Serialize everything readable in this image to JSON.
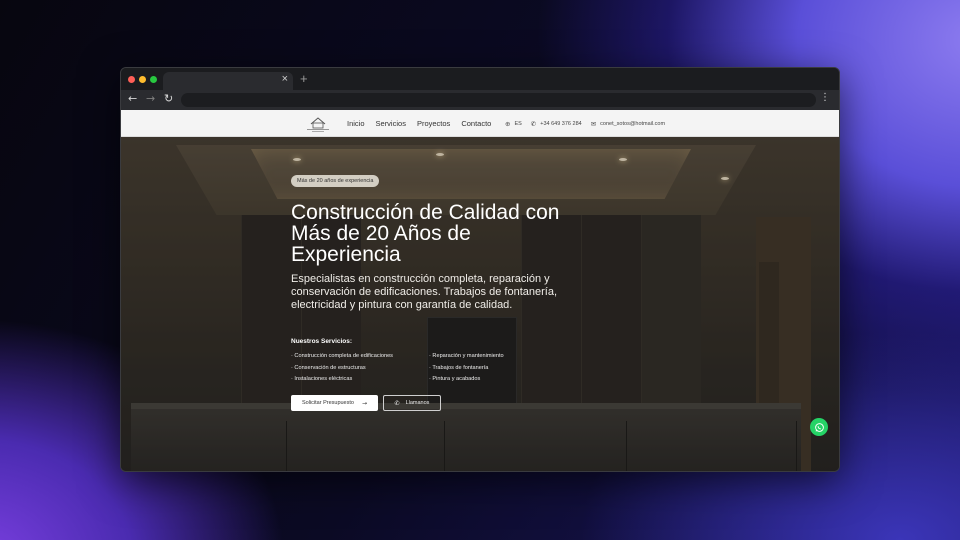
{
  "browser": {
    "tab_close": "×",
    "new_tab": "+",
    "back": "←",
    "forward": "→",
    "reload": "↻",
    "menu": "⋮"
  },
  "header": {
    "nav": [
      "Inicio",
      "Servicios",
      "Proyectos",
      "Contacto"
    ],
    "language": "ES",
    "phone": "+34 649 376 284",
    "email": "conet_sotos@hotmail.com"
  },
  "hero": {
    "badge": "Más de 20 años de experiencia",
    "title": "Construcción de Calidad con Más de 20 Años de Experiencia",
    "subtitle": "Especialistas en construcción completa, reparación y conservación de edificaciones. Trabajos de fontanería, electricidad y pintura con garantía de calidad.",
    "services_title": "Nuestros Servicios:",
    "services_left": [
      "· Construcción completa de edificaciones",
      "· Conservación de estructuras",
      "· Instalaciones eléctricas"
    ],
    "services_right": [
      "· Reparación y mantenimiento",
      "· Trabajos de fontanería",
      "· Pintura y acabados"
    ],
    "cta_primary": "Solicitar Presupuesto",
    "cta_secondary": "Llamanos"
  },
  "icons": {
    "globe": "globe-icon",
    "phone": "phone-icon",
    "mail": "mail-icon",
    "arrow": "arrow-right-icon",
    "whatsapp": "whatsapp-icon"
  },
  "colors": {
    "whatsapp": "#25d366"
  }
}
